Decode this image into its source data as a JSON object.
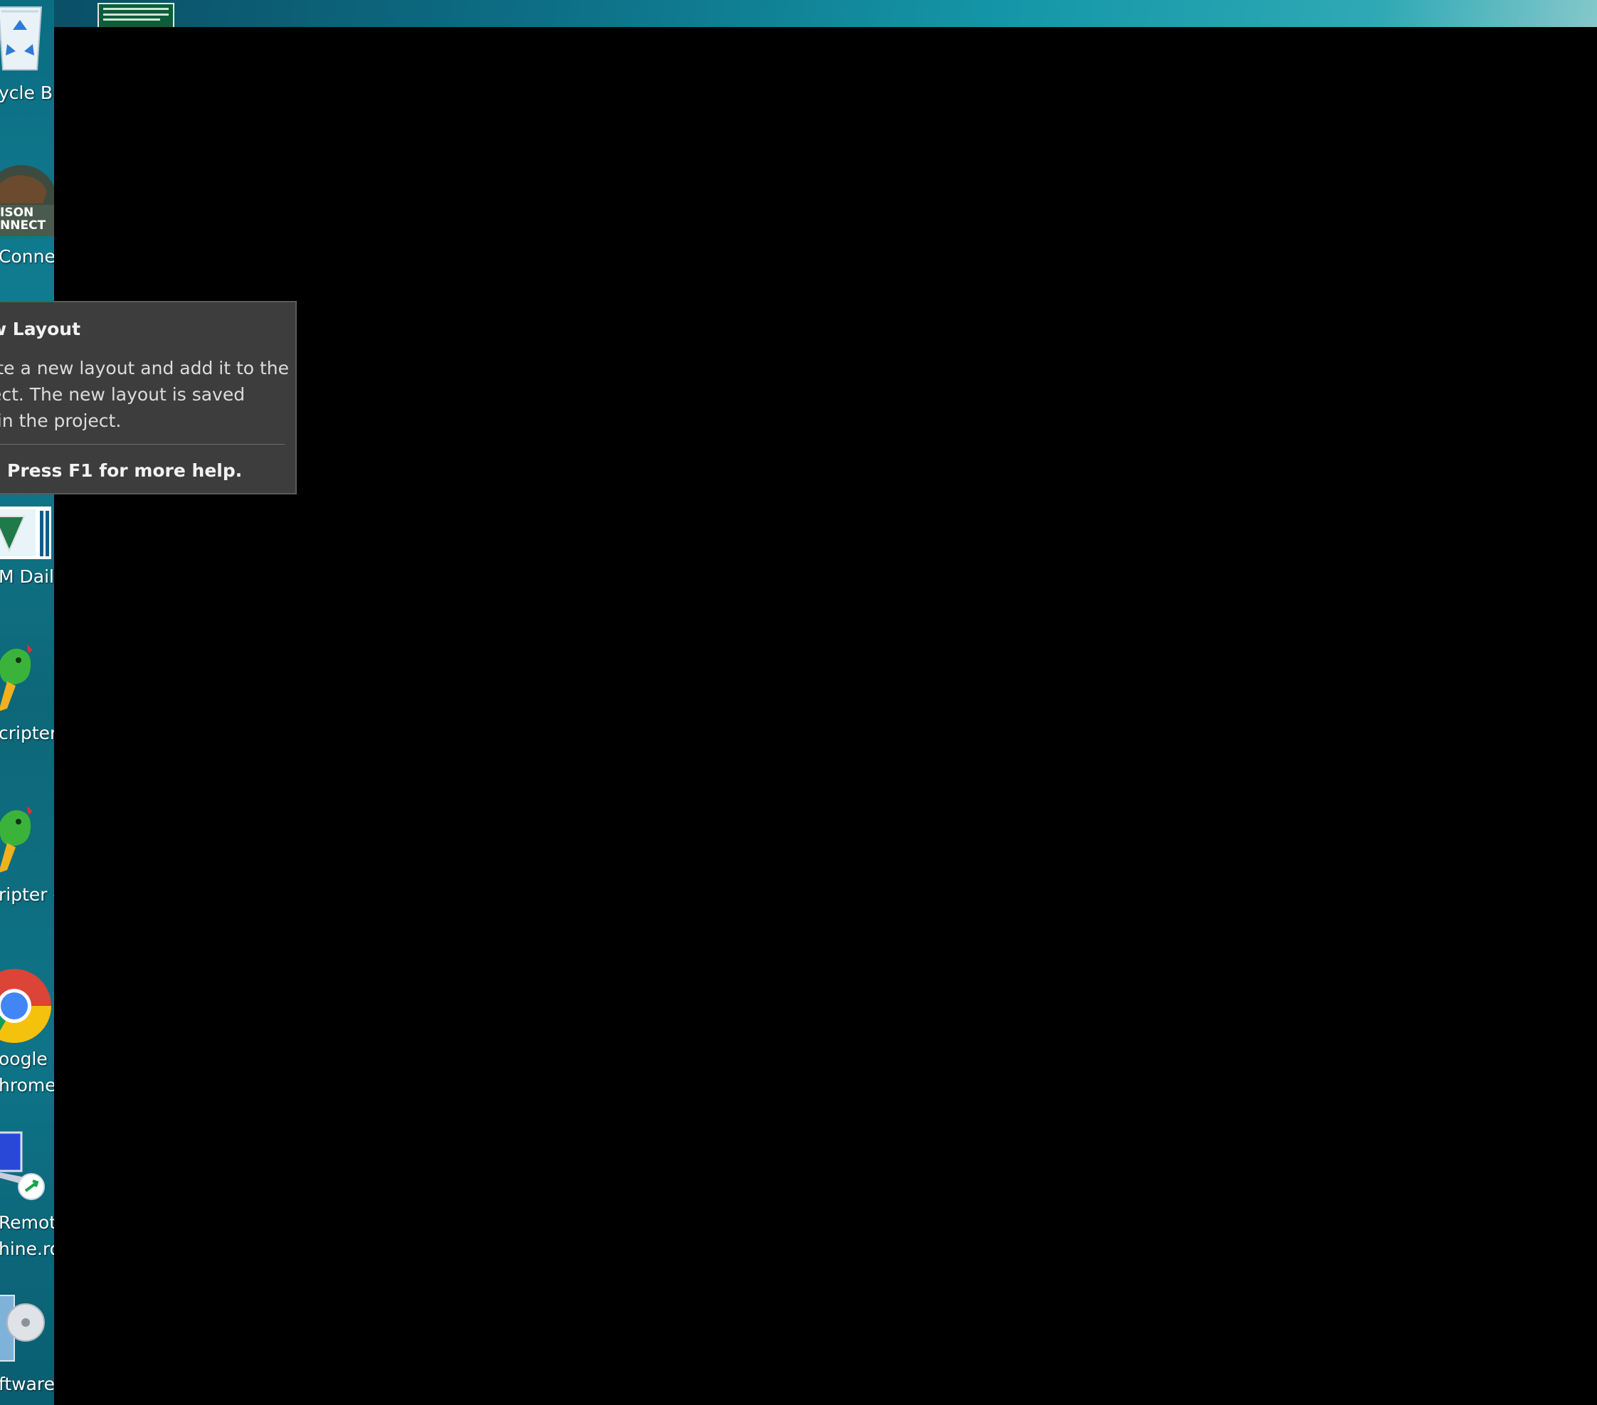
{
  "desktop": {
    "icons": [
      {
        "name": "recycle-bin",
        "label_lines": [
          "ycle Bir"
        ]
      },
      {
        "name": "bison-connect",
        "label_lines": [
          " Conne"
        ],
        "logo_text": [
          "ISON",
          "NNECT"
        ]
      },
      {
        "name": "blm-daily",
        "label_lines": [
          "M Daily"
        ]
      },
      {
        "name": "scripter",
        "label_lines": [
          "cripter"
        ]
      },
      {
        "name": "scripter-2",
        "label_lines": [
          "ripter -"
        ]
      },
      {
        "name": "google-chrome",
        "label_lines": [
          "oogle",
          "hrome"
        ]
      },
      {
        "name": "remote-desktop",
        "label_lines": [
          "Remote",
          "hine.rd"
        ]
      },
      {
        "name": "software",
        "label_lines": [
          "ftware"
        ]
      }
    ]
  },
  "tooltip": {
    "title": "w Layout",
    "body_lines": [
      "ate a new layout and add it to the",
      "ject. The new layout is saved",
      "hin the project."
    ],
    "help": "Press F1 for more help."
  },
  "colors": {
    "window_bg": "#000000",
    "tooltip_bg": "#3d3d3d",
    "desktop_teal": "#0d6f86"
  }
}
